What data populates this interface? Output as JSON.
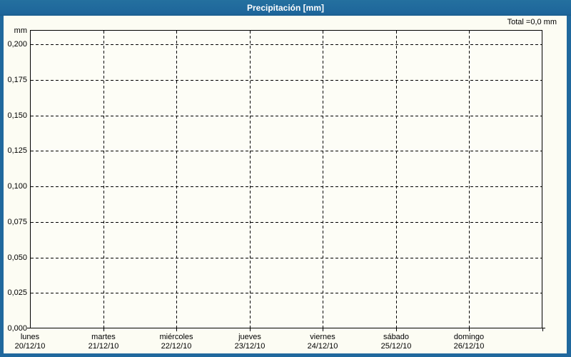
{
  "window": {
    "title": "Precipitación [mm]",
    "total_label": "Total =0,0 mm"
  },
  "chart_data": {
    "type": "bar",
    "title": "Precipitación [mm]",
    "ylabel": "mm",
    "xlabel": "",
    "total_annotation": "Total =0,0 mm",
    "grid": "dashed",
    "legend": "none",
    "y_axis": {
      "unit_label": "mm",
      "tick_labels": [
        "0,200",
        "0,175",
        "0,150",
        "0,125",
        "0,100",
        "0,075",
        "0,050",
        "0,025",
        "0,000"
      ],
      "min": 0,
      "max": 0.21,
      "tick_step": 0.025
    },
    "x_axis": {
      "categories": [
        {
          "day": "lunes",
          "date": "20/12/10"
        },
        {
          "day": "martes",
          "date": "21/12/10"
        },
        {
          "day": "miércoles",
          "date": "22/12/10"
        },
        {
          "day": "jueves",
          "date": "23/12/10"
        },
        {
          "day": "viernes",
          "date": "24/12/10"
        },
        {
          "day": "sábado",
          "date": "25/12/10"
        },
        {
          "day": "domingo",
          "date": "26/12/10"
        }
      ]
    },
    "values": [
      0,
      0,
      0,
      0,
      0,
      0,
      0
    ]
  },
  "colors": {
    "titlebar": "#20689D",
    "frame_border": "#20689D",
    "background": "#FCFCF3",
    "grid": "#000000",
    "text": "#000000",
    "title_text": "#FFFFFF"
  }
}
